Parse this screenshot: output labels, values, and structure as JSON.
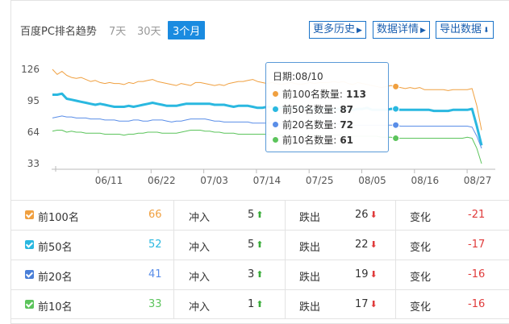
{
  "header": {
    "title": "百度PC排名趋势",
    "ranges": [
      "7天",
      "30天",
      "3个月"
    ],
    "active_range": "3个月",
    "buttons": {
      "history": "更多历史",
      "details": "数据详情",
      "export": "导出数据"
    }
  },
  "tooltip": {
    "date": "日期:08/10",
    "rows": [
      {
        "label": "前100名数量:",
        "value": "113",
        "color": "#f0a040"
      },
      {
        "label": "前50名数量:",
        "value": "87",
        "color": "#2ab8e0"
      },
      {
        "label": "前20名数量:",
        "value": "72",
        "color": "#5a8ee8"
      },
      {
        "label": "前10名数量:",
        "value": "61",
        "color": "#5cc45c"
      }
    ]
  },
  "chart_data": {
    "type": "line",
    "y_ticks": [
      "126",
      "95",
      "64",
      "33"
    ],
    "ylim": [
      33,
      126
    ],
    "x_ticks": [
      "06/11",
      "06/22",
      "07/03",
      "07/14",
      "07/25",
      "08/05",
      "08/16",
      "08/27"
    ],
    "x_range": [
      "05/29",
      "08/29"
    ],
    "series": [
      {
        "name": "前100名",
        "color": "#f0a040",
        "values": [
          126,
          121,
          124,
          120,
          118,
          117,
          118,
          116,
          114,
          115,
          113,
          112,
          113,
          112,
          112,
          111,
          113,
          112,
          114,
          114,
          115,
          116,
          114,
          113,
          112,
          111,
          110,
          112,
          111,
          110,
          113,
          113,
          112,
          111,
          110,
          111,
          110,
          112,
          113,
          114,
          114,
          115,
          116,
          114,
          113,
          112,
          113,
          112,
          111,
          112,
          113,
          112,
          111,
          112,
          113,
          112,
          113,
          113,
          113,
          114,
          113,
          114,
          112,
          111,
          113,
          112,
          111,
          110,
          109,
          108,
          109,
          110,
          109,
          108,
          107,
          108,
          107,
          108,
          106,
          106,
          106,
          106,
          106,
          105,
          106,
          106,
          106,
          106,
          107,
          90,
          66
        ]
      },
      {
        "name": "前50名",
        "color": "#2ab8e0",
        "values": [
          101,
          101,
          102,
          97,
          96,
          95,
          94,
          93,
          92,
          91,
          92,
          91,
          90,
          89,
          89,
          89,
          90,
          89,
          90,
          91,
          92,
          93,
          92,
          91,
          90,
          90,
          90,
          91,
          92,
          92,
          92,
          92,
          92,
          92,
          91,
          91,
          91,
          90,
          89,
          90,
          90,
          90,
          89,
          88,
          88,
          89,
          89,
          88,
          88,
          88,
          87,
          88,
          89,
          88,
          87,
          87,
          87,
          87,
          87,
          87,
          87,
          87,
          86,
          86,
          87,
          87,
          88,
          86,
          86,
          86,
          86,
          87,
          87,
          86,
          86,
          86,
          86,
          86,
          86,
          86,
          85,
          85,
          85,
          85,
          86,
          86,
          86,
          86,
          87,
          70,
          51
        ]
      },
      {
        "name": "前20名",
        "color": "#5a8ee8",
        "values": [
          78,
          79,
          80,
          79,
          79,
          78,
          78,
          78,
          77,
          77,
          77,
          76,
          76,
          76,
          75,
          75,
          75,
          76,
          76,
          75,
          75,
          76,
          76,
          76,
          75,
          74,
          75,
          75,
          76,
          77,
          77,
          77,
          77,
          76,
          75,
          75,
          74,
          74,
          74,
          74,
          74,
          74,
          73,
          73,
          73,
          73,
          73,
          72,
          72,
          73,
          73,
          73,
          72,
          72,
          72,
          72,
          72,
          72,
          72,
          72,
          72,
          72,
          72,
          71,
          71,
          71,
          71,
          71,
          71,
          71,
          71,
          71,
          71,
          70,
          70,
          70,
          70,
          70,
          70,
          70,
          70,
          70,
          70,
          70,
          70,
          70,
          70,
          70,
          69,
          60,
          48
        ]
      },
      {
        "name": "前10名",
        "color": "#5cc45c",
        "values": [
          65,
          66,
          66,
          64,
          65,
          64,
          64,
          63,
          63,
          63,
          63,
          62,
          62,
          62,
          62,
          61,
          62,
          62,
          63,
          63,
          64,
          64,
          64,
          63,
          63,
          63,
          63,
          64,
          65,
          66,
          66,
          66,
          65,
          65,
          64,
          64,
          63,
          63,
          63,
          62,
          62,
          62,
          62,
          62,
          62,
          62,
          61,
          61,
          61,
          61,
          61,
          61,
          61,
          61,
          61,
          61,
          61,
          61,
          61,
          61,
          61,
          61,
          61,
          60,
          60,
          60,
          60,
          60,
          60,
          59,
          59,
          59,
          58,
          58,
          58,
          58,
          58,
          58,
          58,
          58,
          58,
          58,
          58,
          58,
          58,
          58,
          58,
          59,
          58,
          48,
          33
        ]
      }
    ],
    "highlight_index": 72
  },
  "table": {
    "rows": [
      {
        "label": "前100名",
        "count": "66",
        "count_color": "#f0a040",
        "check_color": "#f0a040",
        "in_label": "冲入",
        "in_value": "5",
        "out_label": "跌出",
        "out_value": "26",
        "change_label": "变化",
        "change_value": "-21"
      },
      {
        "label": "前50名",
        "count": "52",
        "count_color": "#2ab8e0",
        "check_color": "#2ab8e0",
        "in_label": "冲入",
        "in_value": "5",
        "out_label": "跌出",
        "out_value": "22",
        "change_label": "变化",
        "change_value": "-17"
      },
      {
        "label": "前20名",
        "count": "41",
        "count_color": "#5a8ee8",
        "check_color": "#4a7fd8",
        "in_label": "冲入",
        "in_value": "3",
        "out_label": "跌出",
        "out_value": "19",
        "change_label": "变化",
        "change_value": "-16"
      },
      {
        "label": "前10名",
        "count": "33",
        "count_color": "#5cc45c",
        "check_color": "#5cc45c",
        "in_label": "冲入",
        "in_value": "1",
        "out_label": "跌出",
        "out_value": "17",
        "change_label": "变化",
        "change_value": "-16"
      }
    ]
  }
}
